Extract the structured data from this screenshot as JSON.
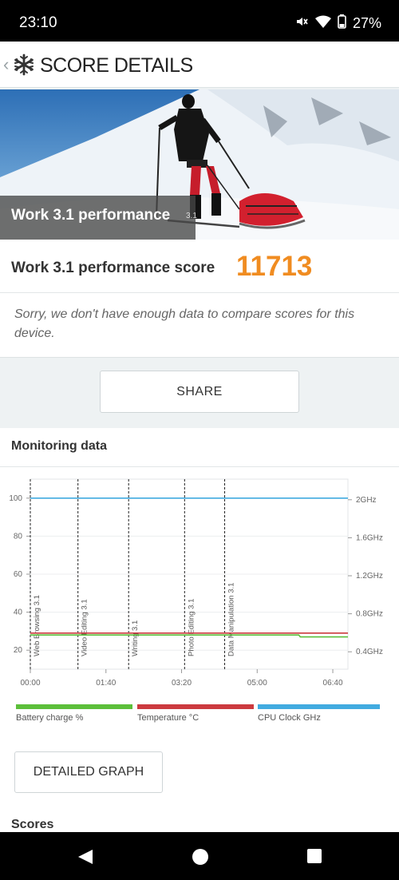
{
  "status_bar": {
    "time": "23:10",
    "battery": "27%"
  },
  "app_bar": {
    "back_icon": "chevron-left-icon",
    "logo_icon": "snowflake-icon",
    "title": "SCORE DETAILS"
  },
  "hero": {
    "caption": "Work 3.1 performance",
    "version": "3.1"
  },
  "score": {
    "label": "Work 3.1 performance score",
    "value": "11713",
    "message": "Sorry, we don't have enough data to compare scores for this device."
  },
  "actions": {
    "share_label": "SHARE",
    "detailed_graph_label": "DETAILED GRAPH"
  },
  "monitoring": {
    "title": "Monitoring data",
    "scores_title": "Scores"
  },
  "colors": {
    "accent": "#f08c21",
    "battery": "#5cbf3a",
    "temperature": "#cc3a3f",
    "cpu": "#41abe0"
  },
  "chart_data": {
    "type": "line",
    "x_ticks": [
      "00:00",
      "01:40",
      "03:20",
      "05:00",
      "06:40"
    ],
    "x_range_minutes": [
      0,
      420
    ],
    "y_left_ticks": [
      "20",
      "40",
      "60",
      "80",
      "100"
    ],
    "y_left_range": [
      10,
      110
    ],
    "y_right_ticks": [
      "0.4GHz",
      "0.8GHz",
      "1.2GHz",
      "1.6GHz",
      "2GHz"
    ],
    "markers": [
      {
        "label": "Web Browsing 3.1",
        "x": 0
      },
      {
        "label": "Video Editing 3.1",
        "x": 63
      },
      {
        "label": "Writing 3.1",
        "x": 130
      },
      {
        "label": "Photo Editing 3.1",
        "x": 204
      },
      {
        "label": "Data Manipulation 3.1",
        "x": 257
      }
    ],
    "series": [
      {
        "name": "Battery charge %",
        "color": "#5cbf3a",
        "x": [
          0,
          355,
          357,
          420
        ],
        "y": [
          28,
          28,
          27,
          27
        ]
      },
      {
        "name": "Temperature °C",
        "color": "#cc3a3f",
        "x": [
          0,
          420
        ],
        "y": [
          29,
          29
        ]
      },
      {
        "name": "CPU Clock GHz",
        "color": "#41abe0",
        "x": [
          0,
          420
        ],
        "y": [
          100,
          100
        ]
      }
    ]
  }
}
